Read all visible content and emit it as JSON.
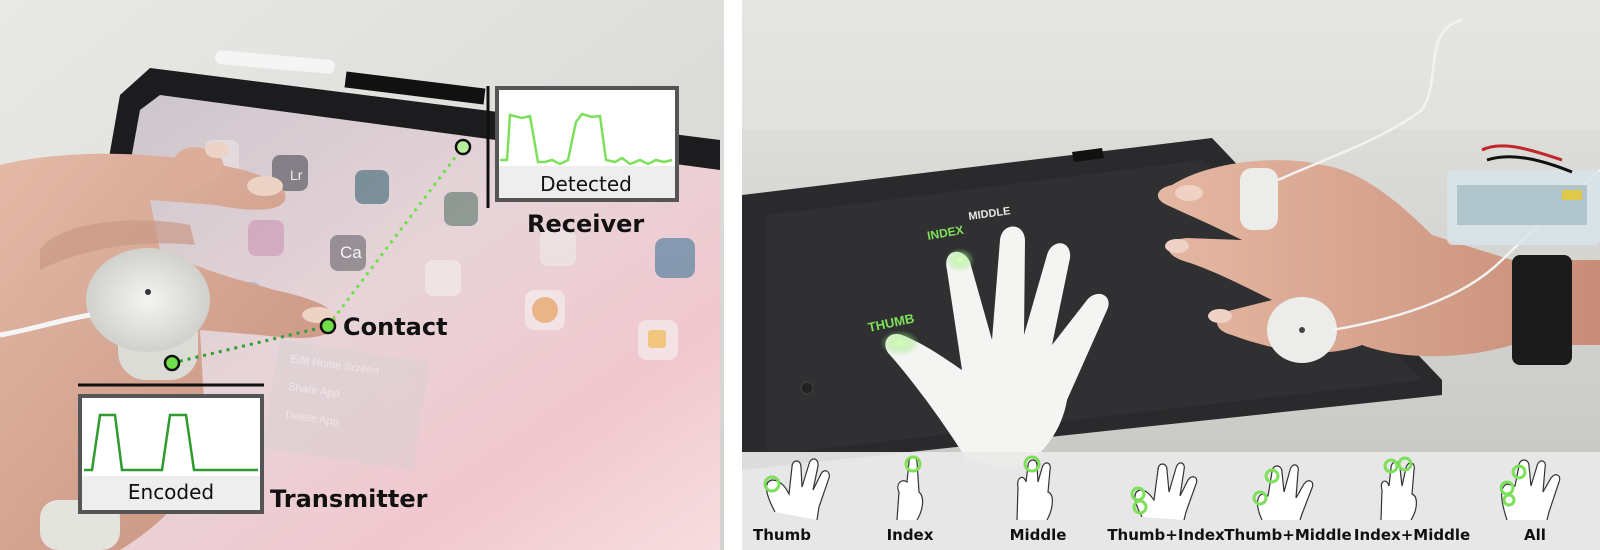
{
  "left": {
    "receiver_graph_label": "Detected",
    "receiver_label": "Receiver",
    "contact_label": "Contact",
    "transmitter_graph_label": "Encoded",
    "transmitter_label": "Transmitter",
    "app_labels": [
      "Lr",
      "Ca"
    ],
    "menu_items": [
      "Edit Home Screen",
      "Share App",
      "Delete App"
    ]
  },
  "right": {
    "screen_finger_labels": [
      "THUMB",
      "INDEX",
      "MIDDLE"
    ],
    "gestures": [
      "Thumb",
      "Index",
      "Middle",
      "Thumb+Index",
      "Thumb+Middle",
      "Index+Middle",
      "All"
    ]
  },
  "colors": {
    "accent_green": "#7ee05a",
    "signal_green": "#2f9a2f"
  }
}
